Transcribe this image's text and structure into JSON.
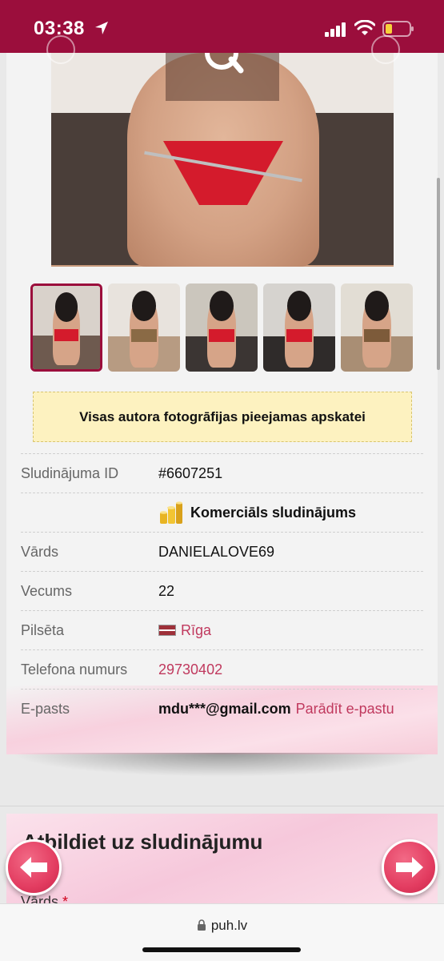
{
  "status_bar": {
    "time": "03:38",
    "background": "#9b0e3c",
    "battery": "low"
  },
  "gallery": {
    "main_photo_alt": "",
    "thumbnail_count": 5,
    "active_thumbnail": 0,
    "notice": "Visas autora fotogrāfijas pieejamas apskatei"
  },
  "details": [
    {
      "label": "Sludinājuma ID",
      "value": "#6607251"
    },
    {
      "label": "",
      "value": "Komerciāls sludinājums",
      "icon": "coins-icon"
    },
    {
      "label": "Vārds",
      "value": "DANIELALOVE69"
    },
    {
      "label": "Vecums",
      "value": "22"
    },
    {
      "label": "Pilsēta",
      "value": "Rīga",
      "icon": "latvia-flag-icon"
    },
    {
      "label": "Telefona numurs",
      "value": "29730402"
    },
    {
      "label": "E-pasts",
      "value": "mdu***@gmail.com",
      "link": "Parādīt e-pastu"
    }
  ],
  "reply": {
    "title": "Atbildiet uz sludinājumu",
    "field_label": "Vārds",
    "required_mark": "*"
  },
  "browser": {
    "url": "puh.lv"
  },
  "colors": {
    "accent": "#9b0e3c",
    "link": "#c0395e",
    "notice_bg": "#fdf2c0"
  }
}
